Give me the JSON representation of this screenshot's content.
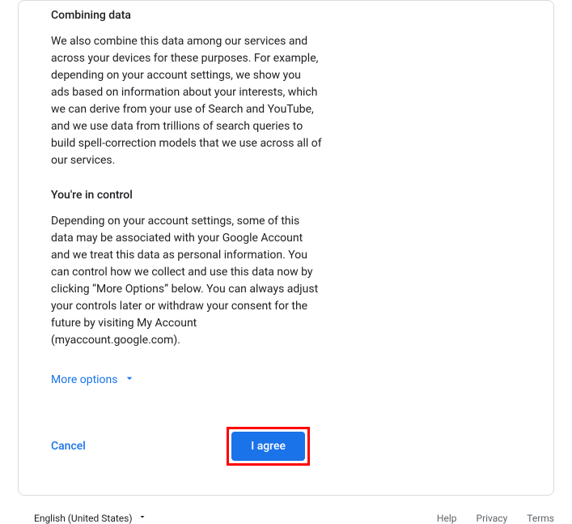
{
  "sections": {
    "combining": {
      "heading": "Combining data",
      "text": "We also combine this data among our services and across your devices for these purposes. For example, depending on your account settings, we show you ads based on information about your interests, which we can derive from your use of Search and YouTube, and we use data from trillions of search queries to build spell-correction models that we use across all of our services."
    },
    "control": {
      "heading": "You're in control",
      "text": "Depending on your account settings, some of this data may be associated with your Google Account and we treat this data as personal information. You can control how we collect and use this data now by clicking “More Options” below. You can always adjust your controls later or withdraw your consent for the future by visiting My Account (myaccount.google.com)."
    }
  },
  "more_options_label": "More options",
  "cancel_label": "Cancel",
  "agree_label": "I agree",
  "language": "English (United States)",
  "footer": {
    "help": "Help",
    "privacy": "Privacy",
    "terms": "Terms"
  }
}
